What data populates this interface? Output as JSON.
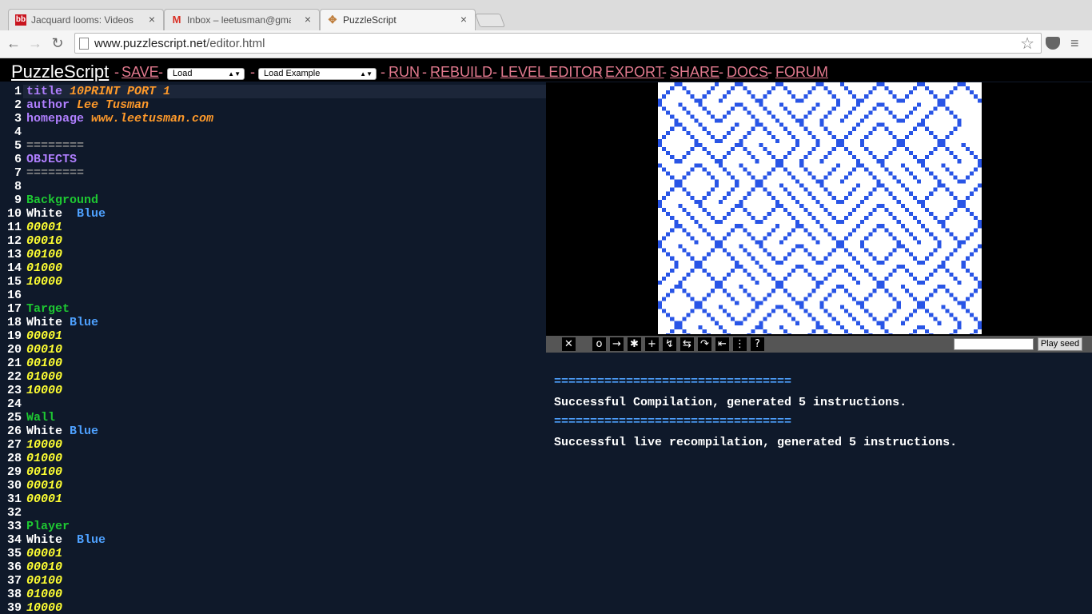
{
  "browser": {
    "tabs": [
      {
        "icon": "bb",
        "title": "Jacquard looms: Videos de"
      },
      {
        "icon": "M",
        "title": "Inbox – leetusman@gmail"
      },
      {
        "icon": "✥",
        "title": "PuzzleScript"
      }
    ],
    "url_host": "www.puzzlescript.net",
    "url_path": "/editor.html"
  },
  "header": {
    "logo": "PuzzleScript",
    "save": "SAVE",
    "load": "Load",
    "load_example": "Load Example",
    "run": "RUN",
    "rebuild": "REBUILD",
    "level_editor": "LEVEL EDITOR",
    "export": "EXPORT",
    "share": "SHARE",
    "docs": "DOCS",
    "forum": "FORUM"
  },
  "editor": {
    "lines": [
      {
        "n": "1",
        "segs": [
          {
            "t": "title ",
            "c": "#b07fff"
          },
          {
            "t": "10PRINT PORT 1",
            "c": "#ff9a2a",
            "i": true
          }
        ]
      },
      {
        "n": "2",
        "segs": [
          {
            "t": "author ",
            "c": "#b07fff"
          },
          {
            "t": "Lee Tusman",
            "c": "#ff9a2a",
            "i": true
          }
        ]
      },
      {
        "n": "3",
        "segs": [
          {
            "t": "homepage ",
            "c": "#b07fff"
          },
          {
            "t": "www.leetusman.com",
            "c": "#ff9a2a",
            "i": true
          }
        ]
      },
      {
        "n": "4",
        "segs": []
      },
      {
        "n": "5",
        "segs": [
          {
            "t": "========",
            "c": "#888888"
          }
        ]
      },
      {
        "n": "6",
        "segs": [
          {
            "t": "OBJECTS",
            "c": "#b07fff"
          }
        ]
      },
      {
        "n": "7",
        "segs": [
          {
            "t": "========",
            "c": "#888888"
          }
        ]
      },
      {
        "n": "8",
        "segs": []
      },
      {
        "n": "9",
        "segs": [
          {
            "t": "Background",
            "c": "#1ec832"
          }
        ]
      },
      {
        "n": "10",
        "segs": [
          {
            "t": "White  ",
            "c": "#ffffff"
          },
          {
            "t": "Blue",
            "c": "#4ea1ff"
          }
        ]
      },
      {
        "n": "11",
        "segs": [
          {
            "t": "00001",
            "c": "#ffff32",
            "i": true
          }
        ]
      },
      {
        "n": "12",
        "segs": [
          {
            "t": "00010",
            "c": "#ffff32",
            "i": true
          }
        ]
      },
      {
        "n": "13",
        "segs": [
          {
            "t": "00100",
            "c": "#ffff32",
            "i": true
          }
        ]
      },
      {
        "n": "14",
        "segs": [
          {
            "t": "01000",
            "c": "#ffff32",
            "i": true
          }
        ]
      },
      {
        "n": "15",
        "segs": [
          {
            "t": "10000",
            "c": "#ffff32",
            "i": true
          }
        ]
      },
      {
        "n": "16",
        "segs": []
      },
      {
        "n": "17",
        "segs": [
          {
            "t": "Target",
            "c": "#1ec832"
          }
        ]
      },
      {
        "n": "18",
        "segs": [
          {
            "t": "White ",
            "c": "#ffffff"
          },
          {
            "t": "Blue",
            "c": "#4ea1ff"
          }
        ]
      },
      {
        "n": "19",
        "segs": [
          {
            "t": "00001",
            "c": "#ffff32",
            "i": true
          }
        ]
      },
      {
        "n": "20",
        "segs": [
          {
            "t": "00010",
            "c": "#ffff32",
            "i": true
          }
        ]
      },
      {
        "n": "21",
        "segs": [
          {
            "t": "00100",
            "c": "#ffff32",
            "i": true
          }
        ]
      },
      {
        "n": "22",
        "segs": [
          {
            "t": "01000",
            "c": "#ffff32",
            "i": true
          }
        ]
      },
      {
        "n": "23",
        "segs": [
          {
            "t": "10000",
            "c": "#ffff32",
            "i": true
          }
        ]
      },
      {
        "n": "24",
        "segs": []
      },
      {
        "n": "25",
        "segs": [
          {
            "t": "Wall",
            "c": "#1ec832"
          }
        ]
      },
      {
        "n": "26",
        "segs": [
          {
            "t": "White ",
            "c": "#ffffff"
          },
          {
            "t": "Blue",
            "c": "#4ea1ff"
          }
        ]
      },
      {
        "n": "27",
        "segs": [
          {
            "t": "10000",
            "c": "#ffff32",
            "i": true
          }
        ]
      },
      {
        "n": "28",
        "segs": [
          {
            "t": "01000",
            "c": "#ffff32",
            "i": true
          }
        ]
      },
      {
        "n": "29",
        "segs": [
          {
            "t": "00100",
            "c": "#ffff32",
            "i": true
          }
        ]
      },
      {
        "n": "30",
        "segs": [
          {
            "t": "00010",
            "c": "#ffff32",
            "i": true
          }
        ]
      },
      {
        "n": "31",
        "segs": [
          {
            "t": "00001",
            "c": "#ffff32",
            "i": true
          }
        ]
      },
      {
        "n": "32",
        "segs": []
      },
      {
        "n": "33",
        "segs": [
          {
            "t": "Player",
            "c": "#1ec832"
          }
        ]
      },
      {
        "n": "34",
        "segs": [
          {
            "t": "White  ",
            "c": "#ffffff"
          },
          {
            "t": "Blue",
            "c": "#4ea1ff"
          }
        ]
      },
      {
        "n": "35",
        "segs": [
          {
            "t": "00001",
            "c": "#ffff32",
            "i": true
          }
        ]
      },
      {
        "n": "36",
        "segs": [
          {
            "t": "00010",
            "c": "#ffff32",
            "i": true
          }
        ]
      },
      {
        "n": "37",
        "segs": [
          {
            "t": "00100",
            "c": "#ffff32",
            "i": true
          }
        ]
      },
      {
        "n": "38",
        "segs": [
          {
            "t": "01000",
            "c": "#ffff32",
            "i": true
          }
        ]
      },
      {
        "n": "39",
        "segs": [
          {
            "t": "10000",
            "c": "#ffff32",
            "i": true
          }
        ]
      }
    ]
  },
  "game": {
    "colors": {
      "fg": "#2955e6",
      "bg": "#ffffff"
    },
    "tile_rows": [
      "/\\//\\/\\/\\\\/\\/\\/\\",
      "\\\\\\/\\\\\\////\\//\\",
      "/\\\\//\\\\\\\\//\\/\\/",
      "\\/\\/\\\\///\\\\/\\/\\\\",
      "\\/\\\\\\/\\\\//\\\\\\\\\\/",
      "/\\///\\\\\\\\//\\\\/\\/",
      "\\\\\\/\\/\\\\\\//\\\\\\/\\",
      "/\\\\/\\//\\\\//\\\\\\\\/",
      "\\\\/\\\\\\/\\/\\\\/\\///",
      "//\\/\\\\/\\/\\\\/\\/\\\\",
      "/\\/\\\\/\\//\\/\\\\/\\/",
      "\\/\\\\//\\\\\\\\\\//\\\\\\",
      "/\\\\\\/\\\\/\\\\\\\\/\\//",
      "\\/\\//\\\\/\\//\\\\/\\\\",
      "/\\\\\\//\\/\\\\/\\/\\//",
      "\\\\/\\\\\\/\\\\/\\\\/\\\\/",
      "//\\/\\\\\\\\/\\\\/\\///",
      "\\/\\/\\\\/\\\\//\\\\\\/\\",
      "/\\\\/\\\\/\\/\\\\/\\/\\/",
      "\\\\/\\/\\/\\\\/\\\\\\\\/\\"
    ],
    "seed_button": "Play seed"
  },
  "toolbar_icons": [
    "✕",
    "o",
    "→",
    "✱",
    "+",
    "↯",
    "⇆",
    "↷",
    "⇤",
    "⋮",
    "?"
  ],
  "console": {
    "sep1": "=================================",
    "msg1": "Successful Compilation, generated 5 instructions.",
    "sep2": "=================================",
    "msg2": "Successful live recompilation, generated 5 instructions."
  }
}
